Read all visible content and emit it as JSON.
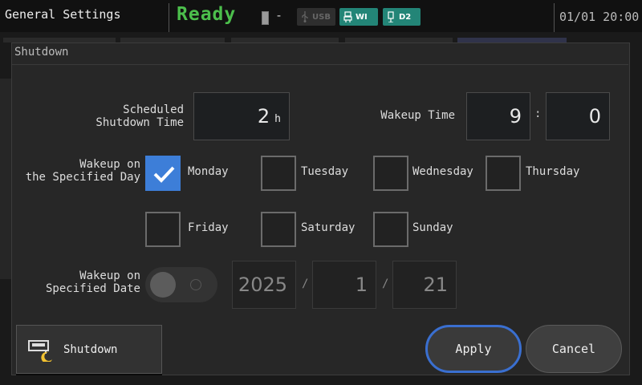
{
  "header": {
    "title": "General Settings",
    "status": "Ready",
    "battery_dash": "-",
    "indicators": {
      "usb": "USB",
      "wi": "WI",
      "d2": "D2"
    },
    "datetime": "01/01 20:00"
  },
  "dialog": {
    "title": "Shutdown",
    "scheduled": {
      "label": "Scheduled\nShutdown Time",
      "value": "2",
      "unit": "h"
    },
    "wakeup_time": {
      "label": "Wakeup Time",
      "hour": "9",
      "sep": ":",
      "minute": "0"
    },
    "wakeup_day": {
      "label": "Wakeup on\nthe Specified Day",
      "days": [
        {
          "name": "Monday",
          "checked": true
        },
        {
          "name": "Tuesday",
          "checked": false
        },
        {
          "name": "Wednesday",
          "checked": false
        },
        {
          "name": "Thursday",
          "checked": false
        },
        {
          "name": "Friday",
          "checked": false
        },
        {
          "name": "Saturday",
          "checked": false
        },
        {
          "name": "Sunday",
          "checked": false
        }
      ]
    },
    "wakeup_date": {
      "label": "Wakeup on\nSpecified Date",
      "enabled": false,
      "year": "2025",
      "month": "1",
      "day": "21",
      "sep": "/"
    },
    "buttons": {
      "shutdown": "Shutdown",
      "apply": "Apply",
      "cancel": "Cancel"
    }
  },
  "colors": {
    "status": "#4cbf4c",
    "accent": "#3d7ed8",
    "indicator": "#238577"
  }
}
